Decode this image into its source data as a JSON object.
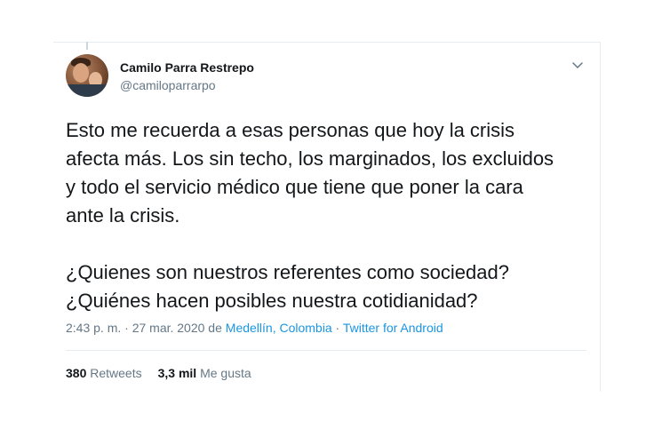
{
  "author": {
    "name": "Camilo Parra Restrepo",
    "handle": "@camiloparrarpo"
  },
  "tweet": {
    "text": "Esto me recuerda a esas personas que hoy la crisis\nafecta más. Los sin techo, los marginados, los excluidos\ny todo el servicio médico que tiene que poner la cara\nante la crisis.\n\n¿Quienes son nuestros referentes como sociedad?\n¿Quiénes hacen posibles nuestra cotidianidad?"
  },
  "meta": {
    "time": "2:43 p. m. · 27 mar. 2020",
    "from_word": " de ",
    "location": "Medellín, Colombia",
    "separator": " · ",
    "source": "Twitter for Android"
  },
  "stats": {
    "retweets_count": "380",
    "retweets_label": "Retweets",
    "likes_count": "3,3 mil",
    "likes_label": "Me gusta"
  },
  "icons": {
    "menu": "chevron-down-icon"
  },
  "colors": {
    "link": "#1b95e0",
    "secondary_text": "#657786",
    "primary_text": "#14171a",
    "border": "#e6ecf0"
  }
}
